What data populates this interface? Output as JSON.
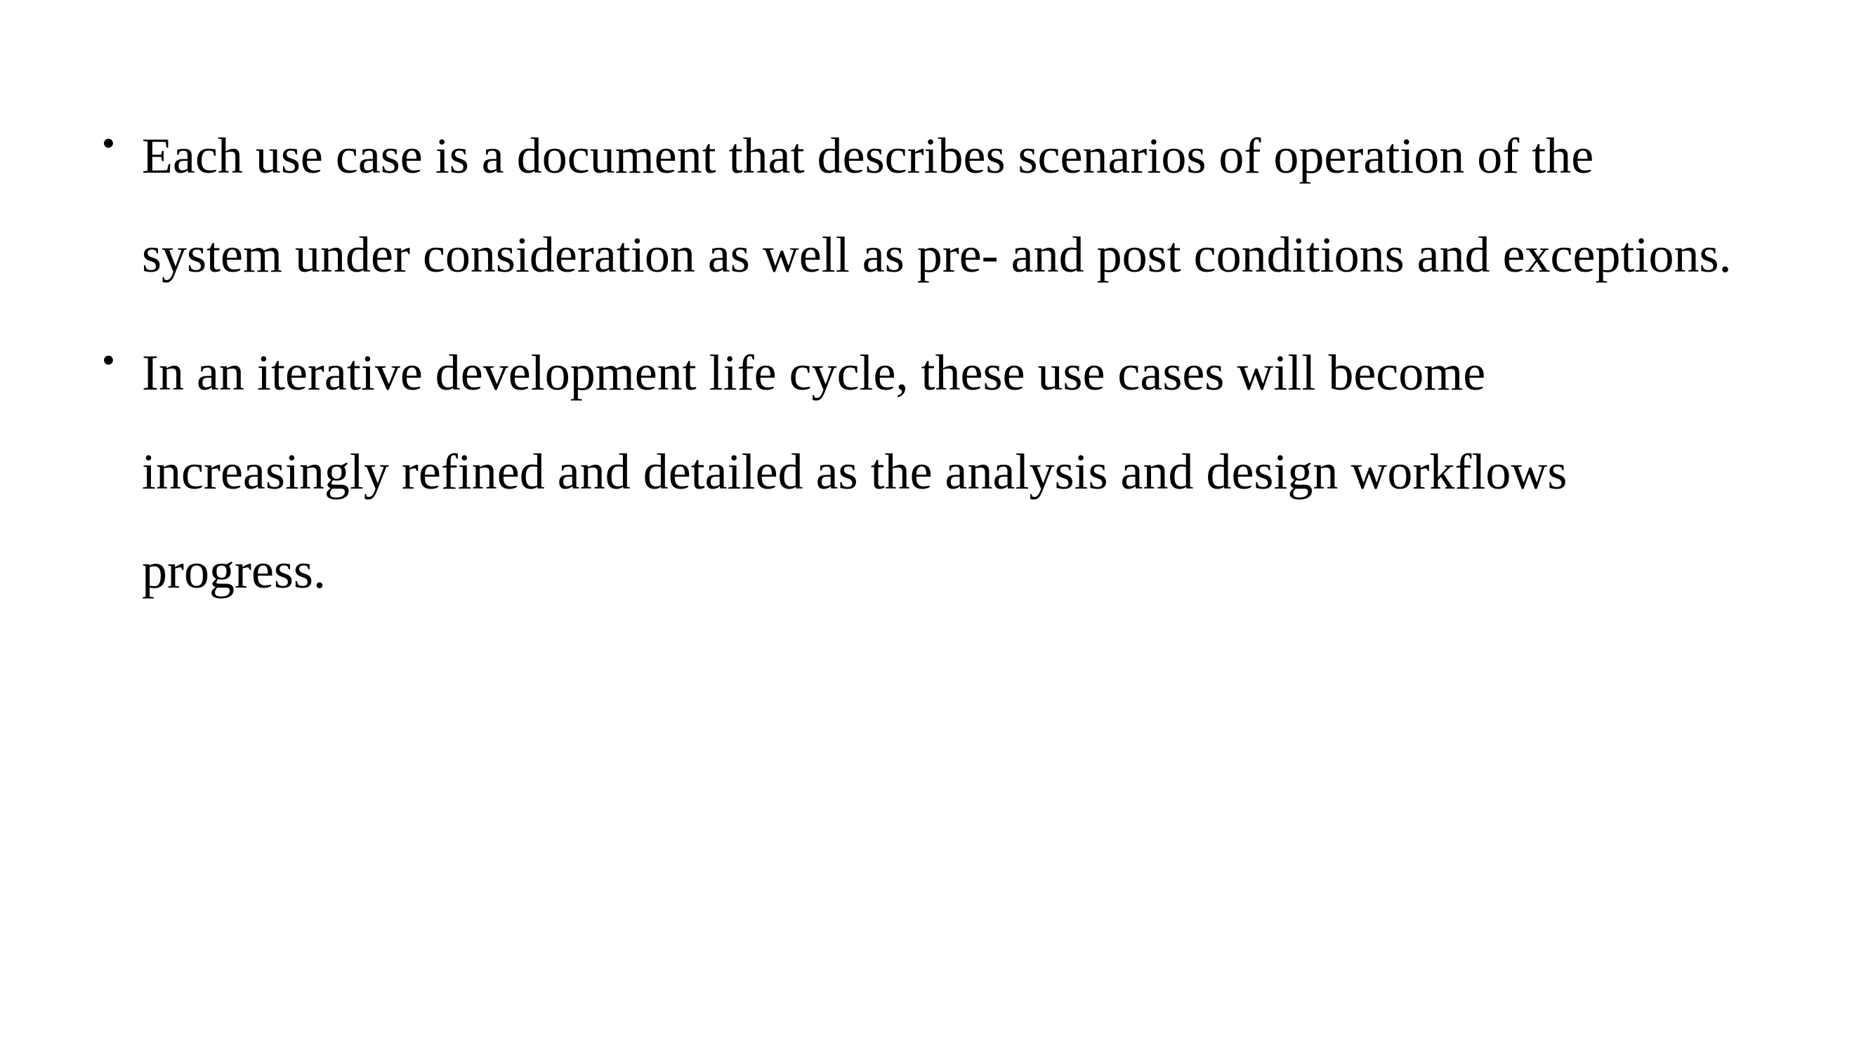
{
  "slide": {
    "bullets": [
      {
        "marker": "•",
        "text": "Each use case is a document that describes scenarios of operation of the system under consideration as well as pre- and post conditions and exceptions."
      },
      {
        "marker": "•",
        "text": "In an iterative development life cycle, these use cases will become increasingly refined and detailed as the analysis and design workflows progress."
      }
    ]
  }
}
